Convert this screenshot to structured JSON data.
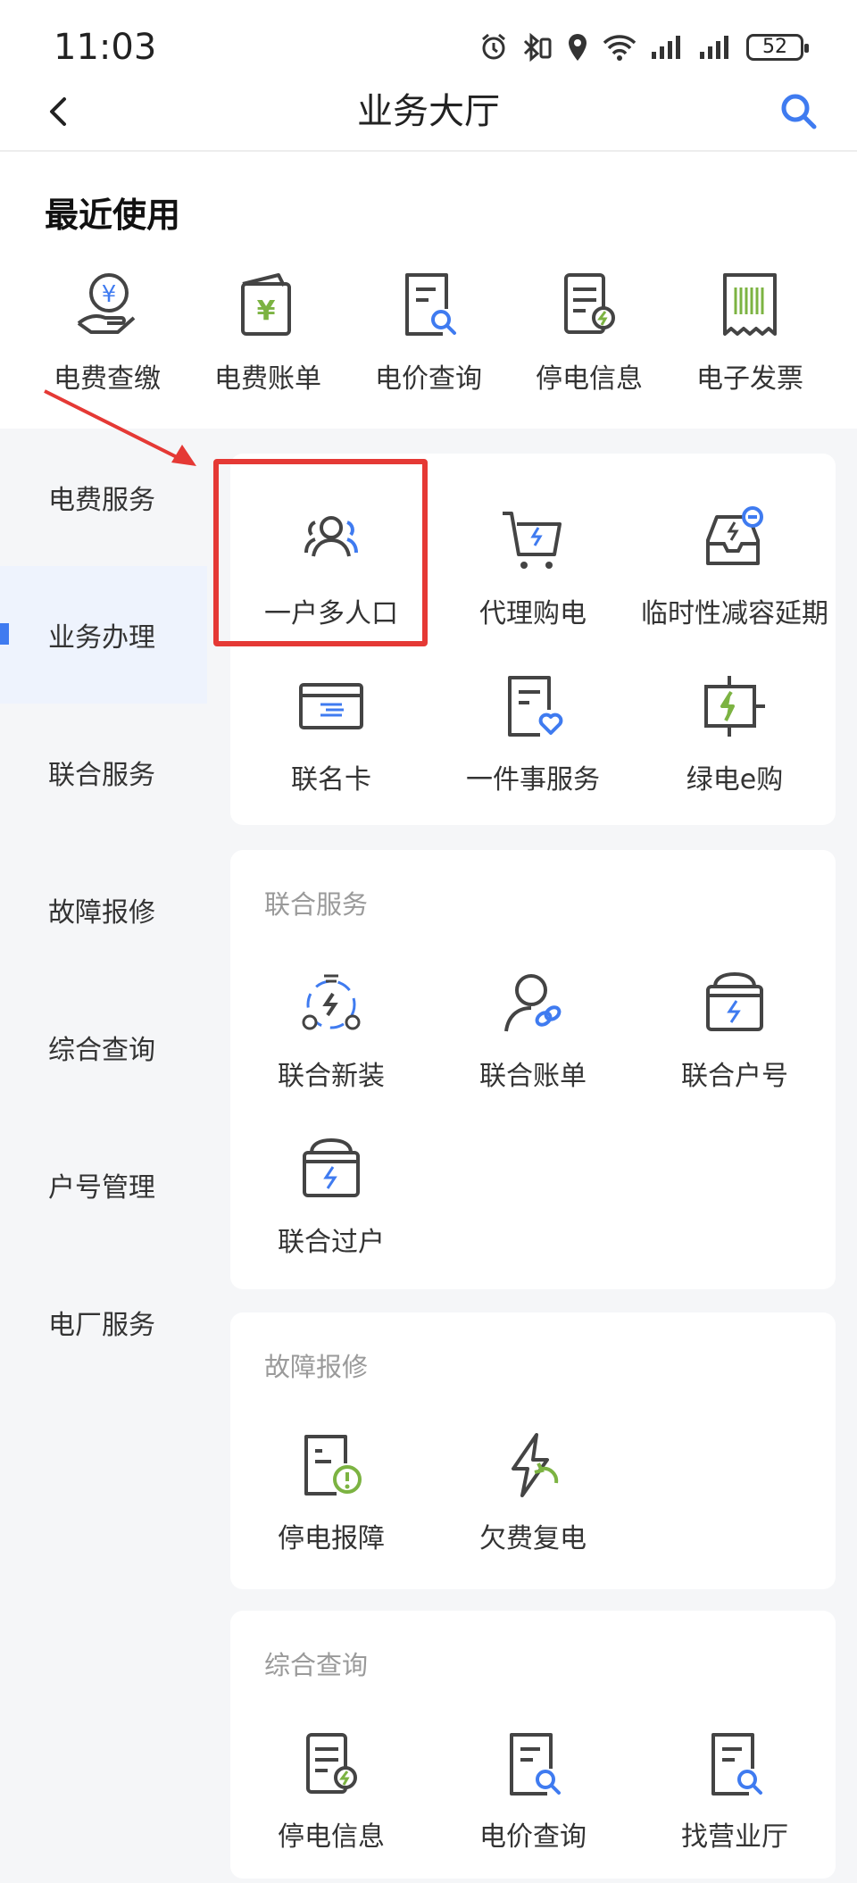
{
  "status_bar": {
    "time": "11:03",
    "battery": "52"
  },
  "nav": {
    "title": "业务大厅"
  },
  "recent": {
    "title": "最近使用",
    "items": [
      {
        "label": "电费查缴",
        "icon": "bill-payment-icon"
      },
      {
        "label": "电费账单",
        "icon": "bill-wallet-icon"
      },
      {
        "label": "电价查询",
        "icon": "price-query-icon"
      },
      {
        "label": "停电信息",
        "icon": "outage-info-icon"
      },
      {
        "label": "电子发票",
        "icon": "e-invoice-icon"
      }
    ]
  },
  "sidebar": {
    "items": [
      {
        "label": "电费服务"
      },
      {
        "label": "业务办理"
      },
      {
        "label": "联合服务"
      },
      {
        "label": "故障报修"
      },
      {
        "label": "综合查询"
      },
      {
        "label": "户号管理"
      },
      {
        "label": "电厂服务"
      }
    ],
    "active_index": 1
  },
  "business": {
    "items": [
      {
        "label": "一户多人口",
        "icon": "multi-person-icon"
      },
      {
        "label": "代理购电",
        "icon": "cart-icon"
      },
      {
        "label": "临时性减容延期",
        "icon": "capacity-icon"
      },
      {
        "label": "联名卡",
        "icon": "card-icon"
      },
      {
        "label": "一件事服务",
        "icon": "heart-doc-icon"
      },
      {
        "label": "绿电e购",
        "icon": "green-power-icon"
      }
    ]
  },
  "joint": {
    "title": "联合服务",
    "items": [
      {
        "label": "联合新装",
        "icon": "joint-install-icon"
      },
      {
        "label": "联合账单",
        "icon": "joint-bill-icon"
      },
      {
        "label": "联合户号",
        "icon": "joint-account-icon"
      },
      {
        "label": "联合过户",
        "icon": "joint-transfer-icon"
      }
    ]
  },
  "repair": {
    "title": "故障报修",
    "items": [
      {
        "label": "停电报障",
        "icon": "outage-report-icon"
      },
      {
        "label": "欠费复电",
        "icon": "restore-power-icon"
      }
    ]
  },
  "query": {
    "title": "综合查询",
    "items": [
      {
        "label": "停电信息",
        "icon": "outage-info-icon"
      },
      {
        "label": "电价查询",
        "icon": "price-query-icon"
      },
      {
        "label": "找营业厅",
        "icon": "find-office-icon"
      }
    ]
  },
  "colors": {
    "accent": "#3f7bf0",
    "highlight": "#e53935",
    "green": "#7cb342"
  }
}
